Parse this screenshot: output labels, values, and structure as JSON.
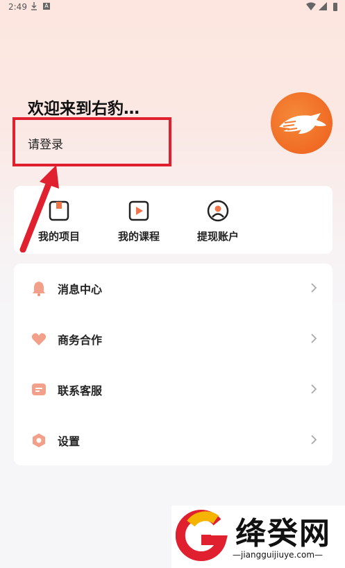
{
  "status_bar": {
    "time": "2:49",
    "a_badge": "A"
  },
  "header": {
    "welcome": "欢迎来到右豹…",
    "login": "请登录"
  },
  "quick_actions": [
    {
      "label": "我的项目",
      "icon": "project-icon"
    },
    {
      "label": "我的课程",
      "icon": "course-icon"
    },
    {
      "label": "提现账户",
      "icon": "account-icon"
    }
  ],
  "menu": [
    {
      "label": "消息中心",
      "icon": "bell-icon"
    },
    {
      "label": "商务合作",
      "icon": "heart-icon"
    },
    {
      "label": "联系客服",
      "icon": "message-icon"
    },
    {
      "label": "设置",
      "icon": "settings-icon"
    }
  ],
  "watermark": {
    "title": "绛癸网",
    "url": "—jiangguijiuye.com—"
  },
  "colors": {
    "accent": "#ee6a2a",
    "highlight": "#e0202e",
    "menu_icon": "#f08f6e"
  }
}
